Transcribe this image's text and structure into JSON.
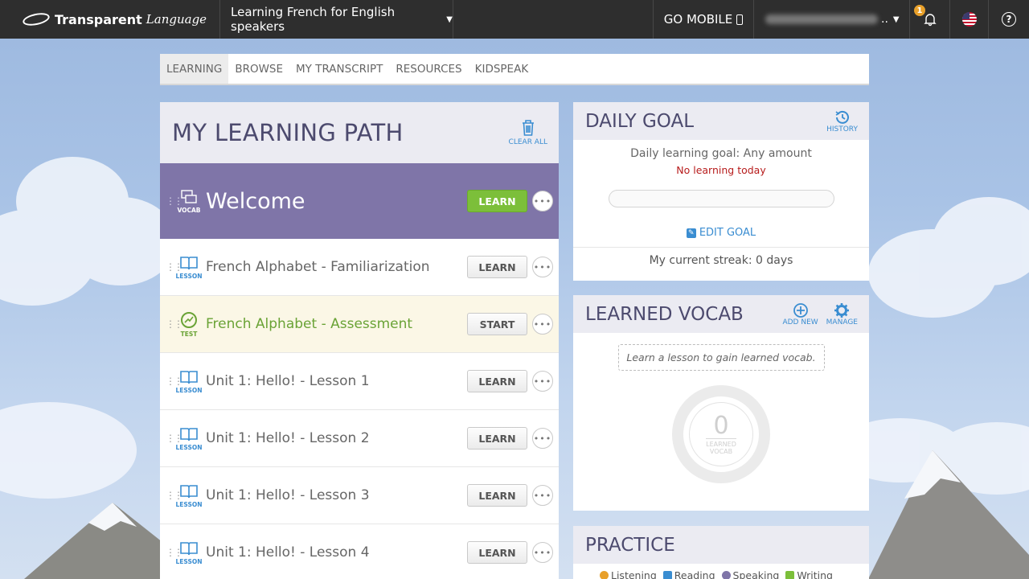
{
  "topbar": {
    "brand": "Transparent",
    "brand_suffix": "Language",
    "course": "Learning French for English speakers",
    "go_mobile": "GO MOBILE",
    "notification_count": "1",
    "help": "?"
  },
  "nav": {
    "tabs": [
      {
        "label": "LEARNING",
        "active": true
      },
      {
        "label": "BROWSE"
      },
      {
        "label": "MY TRANSCRIPT"
      },
      {
        "label": "RESOURCES"
      },
      {
        "label": "KIDSPEAK"
      }
    ]
  },
  "path": {
    "title": "MY LEARNING PATH",
    "clear_all": "CLEAR ALL",
    "rows": [
      {
        "type": "VOCAB",
        "title": "Welcome",
        "button": "LEARN"
      },
      {
        "type": "LESSON",
        "title": "French Alphabet - Familiarization",
        "button": "LEARN"
      },
      {
        "type": "TEST",
        "title": "French Alphabet - Assessment",
        "button": "START"
      },
      {
        "type": "LESSON",
        "title": "Unit 1: Hello! - Lesson 1",
        "button": "LEARN"
      },
      {
        "type": "LESSON",
        "title": "Unit 1: Hello! - Lesson 2",
        "button": "LEARN"
      },
      {
        "type": "LESSON",
        "title": "Unit 1: Hello! - Lesson 3",
        "button": "LEARN"
      },
      {
        "type": "LESSON",
        "title": "Unit 1: Hello! - Lesson 4",
        "button": "LEARN"
      }
    ]
  },
  "daily_goal": {
    "title": "DAILY GOAL",
    "history": "HISTORY",
    "goal_text": "Daily learning goal: Any amount",
    "status": "No learning today",
    "progress": 0,
    "edit_goal": "EDIT GOAL",
    "streak": "My current streak: 0 days"
  },
  "learned_vocab": {
    "title": "LEARNED VOCAB",
    "add_new": "ADD NEW",
    "manage": "MANAGE",
    "note": "Learn a lesson to gain learned vocab.",
    "count": "0",
    "count_label_1": "LEARNED",
    "count_label_2": "VOCAB"
  },
  "practice": {
    "title": "PRACTICE",
    "skills": [
      "Listening",
      "Reading",
      "Speaking",
      "Writing"
    ]
  },
  "colors": {
    "topbar": "#2e2e2e",
    "welcome_row": "#7f75a8",
    "learn_green": "#7cbf3a",
    "link_blue": "#3a8dd1",
    "test_green": "#6aa336",
    "warning_red": "#b71c1c"
  }
}
